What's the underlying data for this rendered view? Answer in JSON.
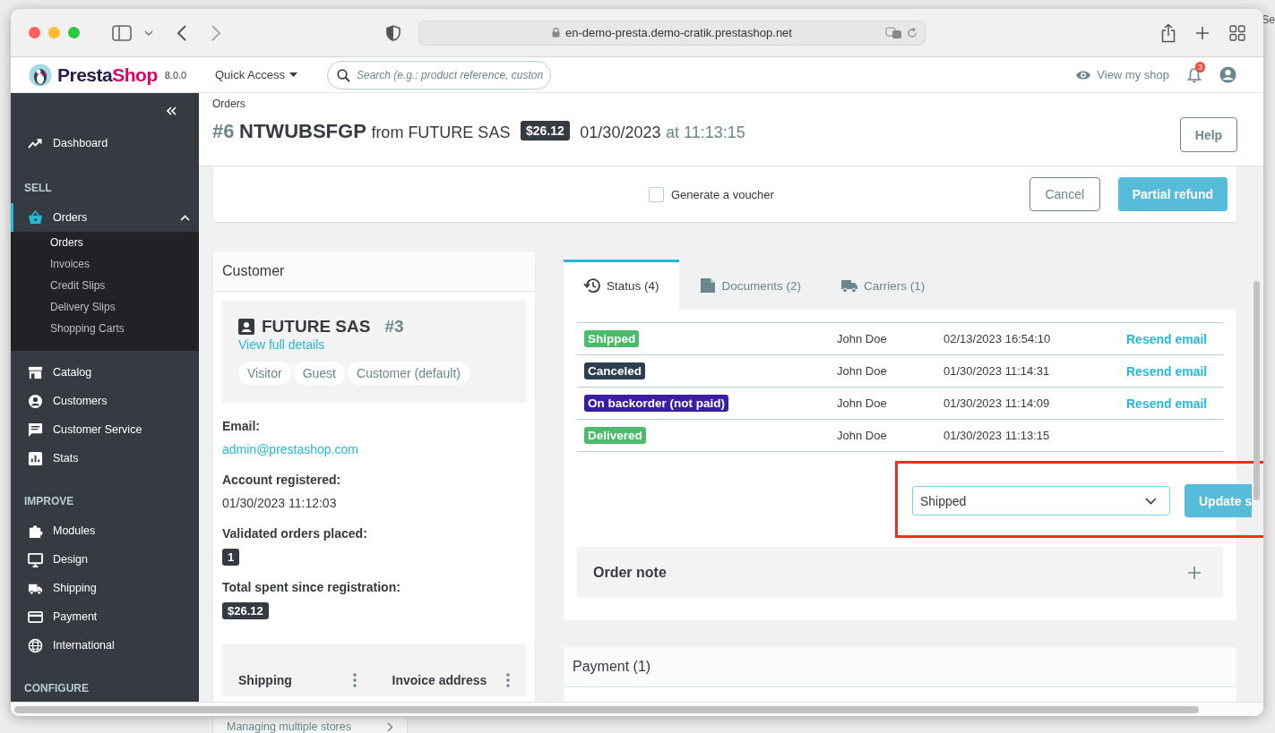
{
  "background": {
    "corner_text": "Se",
    "behind_text": "Managing multiple stores"
  },
  "browser": {
    "url": "en-demo-presta.demo-cratik.prestashop.net"
  },
  "topbar": {
    "brand_parts": [
      "Presta",
      "Shop"
    ],
    "version": "8.0.0",
    "quick_access": "Quick Access",
    "search_placeholder": "Search (e.g.: product reference, custon",
    "view_shop": "View my shop",
    "notifications": "3"
  },
  "sidebar": [
    {
      "kind": "item",
      "label": "Dashboard",
      "selected": false
    },
    {
      "kind": "section",
      "label": "SELL"
    },
    {
      "kind": "parent",
      "label": "Orders",
      "selected": true,
      "expanded": true,
      "children": [
        {
          "label": "Orders",
          "selected": true
        },
        {
          "label": "Invoices",
          "selected": false
        },
        {
          "label": "Credit Slips",
          "selected": false
        },
        {
          "label": "Delivery Slips",
          "selected": false
        },
        {
          "label": "Shopping Carts",
          "selected": false
        }
      ]
    },
    {
      "kind": "item",
      "label": "Catalog",
      "selected": false
    },
    {
      "kind": "item",
      "label": "Customers",
      "selected": false
    },
    {
      "kind": "item",
      "label": "Customer Service",
      "selected": false
    },
    {
      "kind": "item",
      "label": "Stats",
      "selected": false
    },
    {
      "kind": "section",
      "label": "IMPROVE"
    },
    {
      "kind": "item",
      "label": "Modules",
      "selected": false
    },
    {
      "kind": "item",
      "label": "Design",
      "selected": false
    },
    {
      "kind": "item",
      "label": "Shipping",
      "selected": false
    },
    {
      "kind": "item",
      "label": "Payment",
      "selected": false
    },
    {
      "kind": "item",
      "label": "International",
      "selected": false
    },
    {
      "kind": "section",
      "label": "CONFIGURE"
    }
  ],
  "header": {
    "breadcrumb": "Orders",
    "number": "#6",
    "reference": "NTWUBSFGP",
    "from": "from FUTURE SAS",
    "total": "$26.12",
    "date": "01/30/2023",
    "time": "at 11:13:15",
    "help": "Help"
  },
  "refund": {
    "voucher_label": "Generate a voucher",
    "voucher_checked": false,
    "cancel": "Cancel",
    "submit": "Partial refund"
  },
  "customer": {
    "title": "Customer",
    "name": "FUTURE SAS",
    "id": "#3",
    "details_link": "View full details",
    "groups": [
      "Visitor",
      "Guest",
      "Customer (default)"
    ],
    "email_label": "Email:",
    "email": "admin@prestashop.com",
    "registered_label": "Account registered:",
    "registered": "01/30/2023 11:12:03",
    "orders_label": "Validated orders placed:",
    "orders": "1",
    "spent_label": "Total spent since registration:",
    "spent": "$26.12",
    "addresses": [
      "Shipping",
      "Invoice address"
    ]
  },
  "status_panel": {
    "tabs": [
      {
        "label": "Status (4)",
        "selected": true
      },
      {
        "label": "Documents (2)",
        "selected": false
      },
      {
        "label": "Carriers (1)",
        "selected": false
      }
    ],
    "history": [
      {
        "status": "Shipped",
        "color": "#4cbb6c",
        "employee": "John Doe",
        "date": "02/13/2023 16:54:10",
        "action": "Resend email"
      },
      {
        "status": "Canceled",
        "color": "#2c3e50",
        "employee": "John Doe",
        "date": "01/30/2023 11:14:31",
        "action": "Resend email"
      },
      {
        "status": "On backorder (not paid)",
        "color": "#3a1ea2",
        "employee": "John Doe",
        "date": "01/30/2023 11:14:09",
        "action": "Resend email"
      },
      {
        "status": "Delivered",
        "color": "#4cbb6c",
        "employee": "John Doe",
        "date": "01/30/2023 11:13:15"
      }
    ],
    "select_value": "Shipped",
    "update": "Update s",
    "highlighted": true,
    "order_note": "Order note"
  },
  "payment": {
    "title": "Payment (1)"
  }
}
